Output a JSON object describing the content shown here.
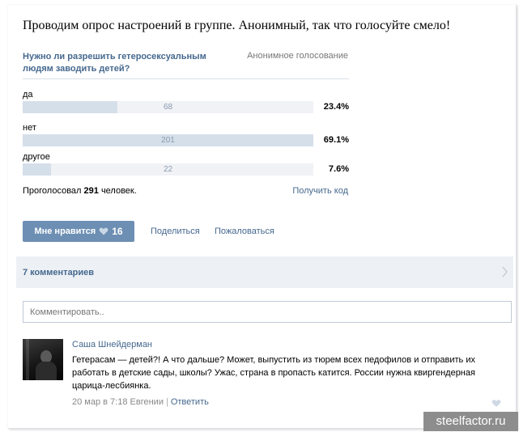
{
  "post": {
    "text": "Проводим опрос настроений в группе. Анонимный, так что голосуйте смело!"
  },
  "poll": {
    "question": "Нужно ли разрешить гетеросексуальным людям заводить детей?",
    "type": "Анонимное голосование",
    "options": [
      {
        "label": "да",
        "count": "68",
        "percent": "23.4%",
        "fraction": 0.327
      },
      {
        "label": "нет",
        "count": "201",
        "percent": "69.1%",
        "fraction": 1.0
      },
      {
        "label": "другое",
        "count": "22",
        "percent": "7.6%",
        "fraction": 0.098
      }
    ],
    "voted_prefix": "Проголосовал",
    "voted_count": "291",
    "voted_suffix": "человек.",
    "get_code": "Получить код"
  },
  "actions": {
    "like_label": "Мне нравится",
    "like_count": "16",
    "share": "Поделиться",
    "report": "Пожаловаться"
  },
  "comments": {
    "title": "7 комментариев",
    "input_placeholder": "Комментировать..",
    "items": [
      {
        "author": "Саша Шнейдерман",
        "text": "Гетерасам — детей?! А что дальше? Может, выпустить из тюрем всех педофилов и отправить их работать в детские сады, школы? Ужас, страна в пропасть катится. России нужна квиргендерная царица-лесбиянка.",
        "date": "20 мар в 7:18",
        "reply_to": "Евгении",
        "reply_label": "Ответить"
      }
    ]
  },
  "watermark": "steelfactor.ru",
  "colors": {
    "link": "#45688e",
    "button": "#6d8fb3",
    "bar_fill": "#d5dfea",
    "bar_track": "#f0f2f5",
    "header_bg": "#edf1f5"
  },
  "icons": {
    "like": "heart-icon",
    "comments_toggle": "chevron-right-icon"
  }
}
